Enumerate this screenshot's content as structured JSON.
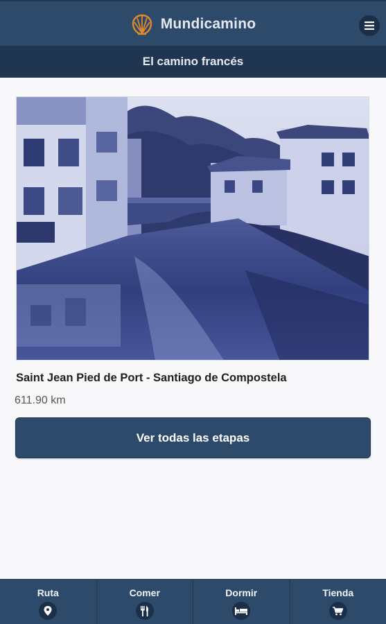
{
  "app": {
    "title": "Mundicamino",
    "logo_icon": "scallop-shell-icon",
    "menu_icon": "hamburger-menu-icon"
  },
  "subheader": {
    "title": "El camino francés"
  },
  "route": {
    "name": "Saint Jean Pied de Port - Santiago de Compostela",
    "distance": "611.90 km",
    "image_icon": "river-town-photo"
  },
  "cta": {
    "label": "Ver todas las etapas"
  },
  "tabs": [
    {
      "label": "Ruta",
      "icon": "map-pin-icon"
    },
    {
      "label": "Comer",
      "icon": "fork-knife-icon"
    },
    {
      "label": "Dormir",
      "icon": "bed-icon"
    },
    {
      "label": "Tienda",
      "icon": "shopping-cart-icon"
    }
  ],
  "colors": {
    "header": "#2e4a6b",
    "subheader": "#1f3550",
    "accent_logo": "#e08a2a",
    "background": "#f8f8fa"
  }
}
